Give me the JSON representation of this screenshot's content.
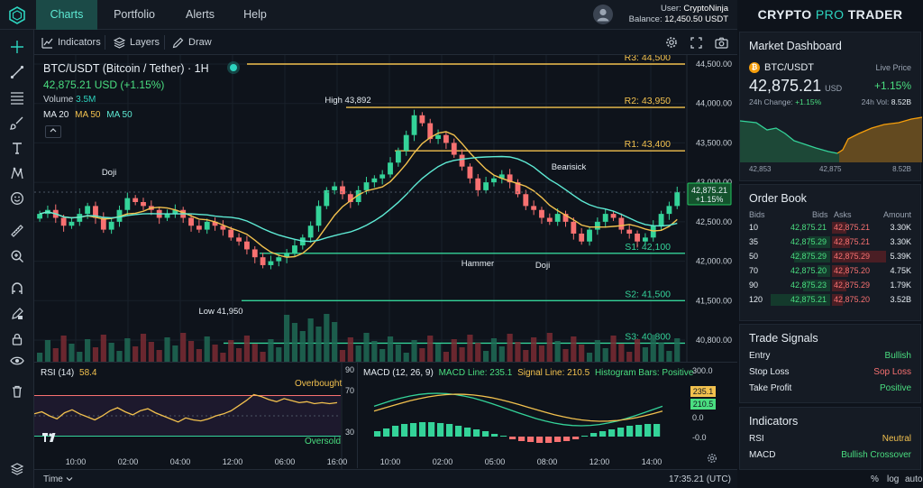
{
  "nav": {
    "tabs": [
      {
        "label": "Charts",
        "active": true
      },
      {
        "label": "Portfolio",
        "active": false
      },
      {
        "label": "Alerts",
        "active": false
      },
      {
        "label": "Help",
        "active": false
      }
    ],
    "user_label": "User:",
    "user_name": "CryptoNinja",
    "balance_label": "Balance:",
    "balance_value": "12,450.50 USDT"
  },
  "brand": {
    "part1": "CRYPTO",
    "part2": "PRO",
    "part3": "TRADER"
  },
  "toolbar": {
    "indicators": "Indicators",
    "layers": "Layers",
    "draw": "Draw"
  },
  "chart": {
    "title": "BTC/USDT (Bitcoin / Tether) · 1H",
    "price": "42,875.21 USD (+1.15%)",
    "volume_label": "Volume",
    "volume_value": "3.5M",
    "ma20": "MA 20",
    "ma50a": "MA 50",
    "ma50b": "MA 50",
    "current_price_tag": "42,875.21",
    "current_change_tag": "+1.15%",
    "annotations": {
      "high": "High 43,892",
      "low": "Low 41,950",
      "doji_left": "Doji",
      "bearish": "Bearisick",
      "hammer": "Hammer",
      "doji_right": "Doji"
    },
    "levels": [
      {
        "label": "R3: 44,500",
        "price": 44500,
        "color": "#f2c14e"
      },
      {
        "label": "R2: 43,950",
        "price": 43950,
        "color": "#f2c14e"
      },
      {
        "label": "R1: 43,400",
        "price": 43400,
        "color": "#f2c14e"
      },
      {
        "label": "S1: 42,100",
        "price": 42100,
        "color": "#34d399"
      },
      {
        "label": "S2: 41,500",
        "price": 41500,
        "color": "#34d399"
      },
      {
        "label": "S3: 40,800",
        "price": 40800,
        "color": "#34d399"
      }
    ]
  },
  "chart_data": {
    "type": "candlestick",
    "y_ticks": [
      "44,500.00",
      "44,000.00",
      "43,500.00",
      "43,000.00",
      "42,500.00",
      "42,000.00",
      "41,500.00",
      "40,800.00"
    ],
    "y_tick_values": [
      44500,
      44000,
      43500,
      43000,
      42500,
      42000,
      41500,
      41000
    ],
    "x_ticks": [
      "10:00",
      "02:00",
      "04:00",
      "12:00",
      "06:00",
      "16:00",
      "10:00",
      "02:00",
      "05:00",
      "08:00",
      "12:00",
      "14:00"
    ],
    "current_price": 42875.21,
    "series_close": [
      42600,
      42650,
      42550,
      42450,
      42500,
      42600,
      42700,
      42550,
      42400,
      42500,
      42650,
      42800,
      42750,
      42700,
      42650,
      42550,
      42600,
      42650,
      42550,
      42450,
      42400,
      42500,
      42450,
      42400,
      42300,
      42250,
      42150,
      42050,
      41950,
      42000,
      42050,
      42100,
      42200,
      42300,
      42450,
      42700,
      42900,
      42950,
      42850,
      42750,
      42900,
      43000,
      43050,
      43100,
      43250,
      43400,
      43600,
      43850,
      43750,
      43550,
      43600,
      43500,
      43350,
      43200,
      43050,
      42900,
      43000,
      43050,
      43100,
      43000,
      42850,
      42700,
      42650,
      42550,
      42500,
      42600,
      42500,
      42350,
      42250,
      42400,
      42500,
      42600,
      42550,
      42400,
      42350,
      42250,
      42300,
      42450,
      42600,
      42700,
      42875
    ],
    "rsi": {
      "label": "RSI (14)",
      "value": "58.4",
      "overbought": "Overbought",
      "oversold": "Oversold",
      "ticks": [
        "90",
        "70",
        "30"
      ],
      "upper": 70,
      "lower": 30
    },
    "macd": {
      "label": "MACD (12, 26, 9)",
      "macd_line": "MACD Line: 235.1",
      "signal_line": "Signal Line: 210.5",
      "histogram": "Histogram Bars: Positive",
      "tag_macd": "235.1",
      "tag_signal": "210.5",
      "ticks": [
        "300.0",
        "0.0",
        "-0.0"
      ]
    }
  },
  "bottom": {
    "time_label": "Time",
    "clock": "17:35.21 (UTC)",
    "percent": "%",
    "log": "log",
    "auto": "auto"
  },
  "dashboard": {
    "title": "Market Dashboard",
    "pair": "BTC/USDT",
    "live_price_label": "Live Price",
    "price": "42,875.21",
    "currency": "USD",
    "change": "+1.15%",
    "change_24h_label": "24h Change:",
    "change_24h_value": "+1.15%",
    "vol_label": "24h Vol:",
    "vol_value": "8.52B",
    "spark_labels": [
      "42,853",
      "42,875",
      "8.52B"
    ]
  },
  "orderbook": {
    "title": "Order Book",
    "headers": [
      "Bids",
      "Bids",
      "Asks",
      "Amount"
    ],
    "rows": [
      {
        "qty": "10",
        "bid": "42,875.21",
        "ask": "42,875.21",
        "amount": "3.30K"
      },
      {
        "qty": "35",
        "bid": "42,875.29",
        "ask": "42,875.21",
        "amount": "3.30K"
      },
      {
        "qty": "50",
        "bid": "42,875.29",
        "ask": "42,875.29",
        "amount": "5.39K"
      },
      {
        "qty": "70",
        "bid": "42,875.20",
        "ask": "42,875.20",
        "amount": "4.75K"
      },
      {
        "qty": "90",
        "bid": "42,875.23",
        "ask": "42,875.29",
        "amount": "1.79K"
      },
      {
        "qty": "120",
        "bid": "42,875.21",
        "ask": "42,875.20",
        "amount": "3.52B"
      }
    ]
  },
  "signals": {
    "title": "Trade Signals",
    "rows": [
      {
        "label": "Entry",
        "value": "Bullish",
        "color": "#4ade80"
      },
      {
        "label": "Stop Loss",
        "value": "Sop Loss",
        "color": "#f87171"
      },
      {
        "label": "Take Profit",
        "value": "Positive",
        "color": "#4ade80"
      }
    ]
  },
  "indicators": {
    "title": "Indicators",
    "rows": [
      {
        "label": "RSI",
        "value": "Neutral",
        "color": "#f2c14e"
      },
      {
        "label": "MACD",
        "value": "Bullish Crossover",
        "color": "#4ade80"
      }
    ]
  }
}
